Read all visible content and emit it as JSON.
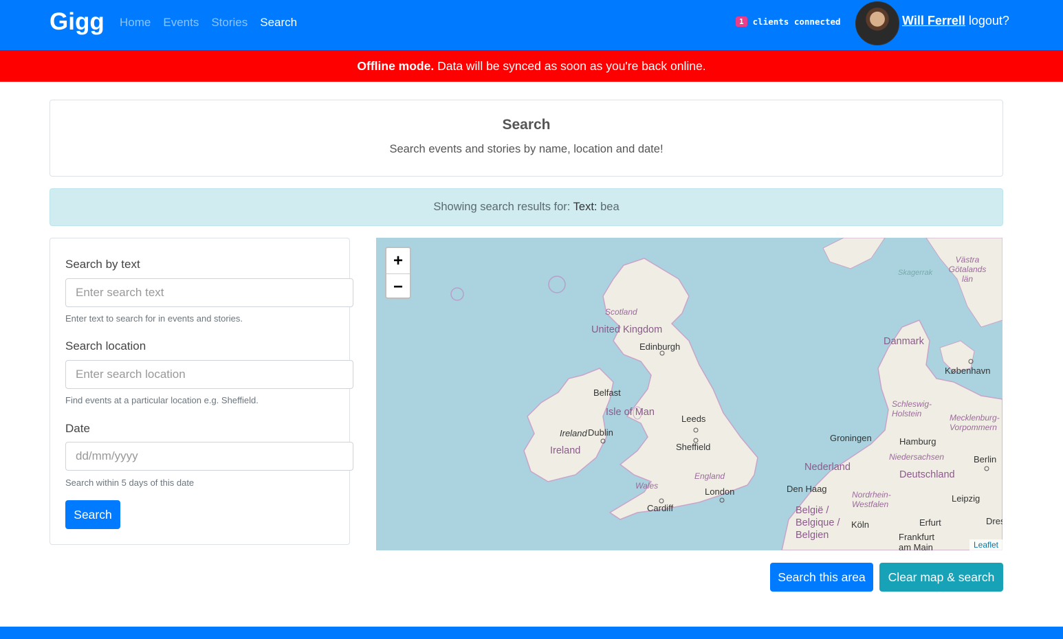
{
  "nav": {
    "brand": "Gigg",
    "links": [
      "Home",
      "Events",
      "Stories",
      "Search"
    ],
    "clients_count": "1",
    "clients_label": "clients connected",
    "user_name": "Will Ferrell",
    "logout_label": "logout?"
  },
  "offline": {
    "bold": "Offline mode.",
    "text": " Data will be synced as soon as you're back online."
  },
  "header": {
    "title": "Search",
    "subtitle": "Search events and stories by name, location and date!"
  },
  "results": {
    "prefix": "Showing search results for: ",
    "key": "Text:",
    "value": " bea"
  },
  "form": {
    "text_label": "Search by text",
    "text_placeholder": "Enter search text",
    "text_help": "Enter text to search for in events and stories.",
    "location_label": "Search location",
    "location_placeholder": "Enter search location",
    "location_help": "Find events at a particular location e.g. Sheffield.",
    "date_label": "Date",
    "date_placeholder": "dd/mm/yyyy",
    "date_help": "Search within 5 days of this date",
    "submit_label": "Search"
  },
  "map": {
    "zoom_in": "+",
    "zoom_out": "−",
    "attribution": "Leaflet",
    "labels": {
      "scotland": "Scotland",
      "uk": "United Kingdom",
      "edinburgh": "Edinburgh",
      "belfast": "Belfast",
      "isle_of_man": "Isle of Man",
      "leeds": "Leeds",
      "ireland_city": "Ireland",
      "dublin": "Dublin",
      "ireland": "Ireland",
      "sheffield": "Sheffield",
      "england": "England",
      "wales": "Wales",
      "london": "London",
      "cardiff": "Cardiff",
      "danmark": "Danmark",
      "kobenhavn": "København",
      "skagerrak": "Skagerrak",
      "vastra": "Västra Götalands län",
      "schleswig": "Schleswig-Holstein",
      "mecklenburg": "Mecklenburg-Vorpommern",
      "groningen": "Groningen",
      "hamburg": "Hamburg",
      "niedersachsen": "Niedersachsen",
      "berlin": "Berlin",
      "nederland": "Nederland",
      "deutschland": "Deutschland",
      "den_haag": "Den Haag",
      "nordrhein": "Nordrhein-Westfalen",
      "leipzig": "Leipzig",
      "belgie": "België / Belgique / Belgien",
      "koln": "Köln",
      "erfurt": "Erfurt",
      "dresden": "Dresd",
      "frankfurt": "Frankfurt am Main"
    }
  },
  "actions": {
    "search_area": "Search this area",
    "clear": "Clear map & search"
  },
  "colors": {
    "primary": "#007bff",
    "offline": "#ff0000",
    "info": "#17a2b8",
    "alert_bg": "#d1ecf1",
    "sea": "#aad3df",
    "land": "#f0eee4"
  }
}
